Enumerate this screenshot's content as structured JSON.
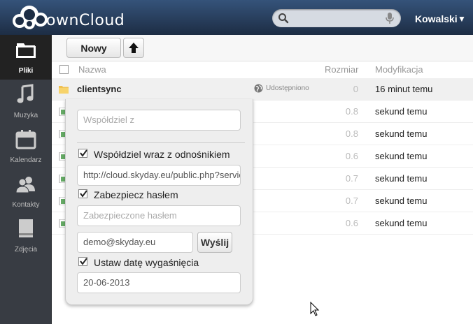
{
  "app": {
    "logo_text": "ownCloud"
  },
  "header": {
    "username": "Kowalski",
    "search_placeholder": ""
  },
  "nav": {
    "items": [
      {
        "label": "Pliki",
        "icon": "folder-icon",
        "active": true
      },
      {
        "label": "Muzyka",
        "icon": "music-icon",
        "active": false
      },
      {
        "label": "Kalendarz",
        "icon": "calendar-icon",
        "active": false
      },
      {
        "label": "Kontakty",
        "icon": "contacts-icon",
        "active": false
      },
      {
        "label": "Zdjęcia",
        "icon": "photo-icon",
        "active": false
      }
    ]
  },
  "controls": {
    "new_label": "Nowy"
  },
  "table": {
    "headers": {
      "name": "Nazwa",
      "size": "Rozmiar",
      "modified": "Modyfikacja"
    },
    "rows": [
      {
        "name": "clientsync",
        "type": "folder",
        "shared": "Udostępniono",
        "size": "0",
        "modified": "16 minut temu"
      },
      {
        "name": "",
        "type": "file",
        "size": "0.8",
        "modified": "sekund temu"
      },
      {
        "name": "",
        "type": "file",
        "size": "0.8",
        "modified": "sekund temu"
      },
      {
        "name": "",
        "type": "file",
        "size": "0.6",
        "modified": "sekund temu"
      },
      {
        "name": "",
        "type": "file",
        "size": "0.7",
        "modified": "sekund temu"
      },
      {
        "name": "",
        "type": "file",
        "size": "0.7",
        "modified": "sekund temu"
      },
      {
        "name": "",
        "type": "file",
        "size": "0.6",
        "modified": "sekund temu"
      }
    ]
  },
  "share": {
    "share_with_placeholder": "Współdziel z",
    "link_label": "Współdziel wraz z odnośnikiem",
    "link_checked": true,
    "link_url": "http://cloud.skyday.eu/public.php?service",
    "password_label": "Zabezpiecz hasłem",
    "password_checked": true,
    "password_placeholder": "Zabezpieczone hasłem",
    "email_value": "demo@skyday.eu",
    "send_label": "Wyślij",
    "expire_label": "Ustaw datę wygaśnięcia",
    "expire_checked": true,
    "expire_date": "20-06-2013"
  },
  "colors": {
    "header": "#1d2d44",
    "sidebar": "#383c43"
  }
}
